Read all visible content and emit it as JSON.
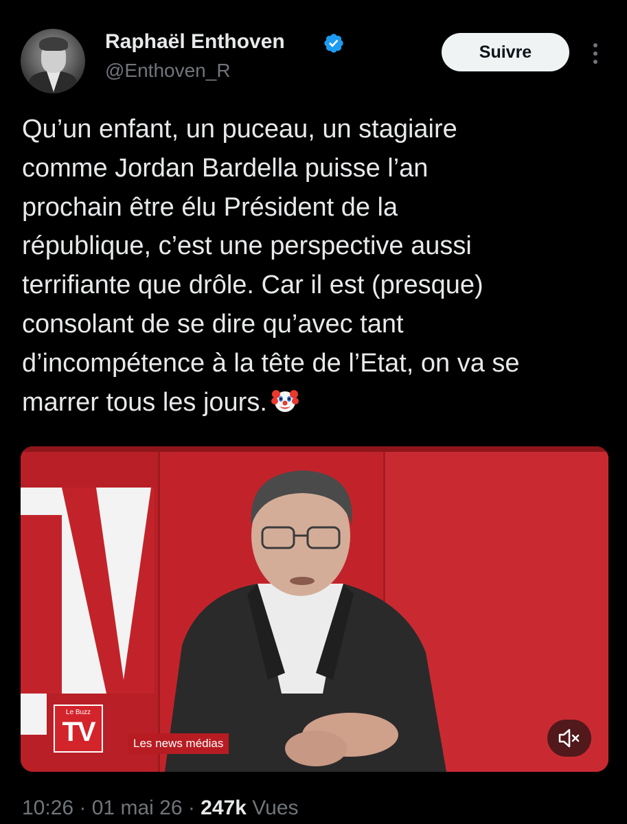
{
  "author": {
    "display_name": "Raphaël Enthoven",
    "handle": "@Enthoven_R",
    "verified": true,
    "avatar_icon": "profile-photo"
  },
  "actions": {
    "follow_label": "Suivre",
    "more_icon": "more-vertical-icon"
  },
  "tweet": {
    "lines": [
      "Qu’un enfant, un puceau, un stagiaire",
      "comme Jordan Bardella puisse l’an",
      "prochain être élu Président de la",
      "république, c’est une perspective aussi",
      "terrifiante que drôle. Car il est (presque)",
      "consolant de se dire qu’avec tant",
      "d’incompétence à la tête de l’Etat, on va se",
      "marrer tous les jours."
    ],
    "emoji_icon": "clown-face-icon"
  },
  "media": {
    "type": "video",
    "background_sign_text": "TV",
    "logo_small": "Le Buzz",
    "logo_big": "TV",
    "lower_third": "Les news médias",
    "mute_icon": "speaker-muted-icon"
  },
  "meta": {
    "time": "10:26",
    "separator": " · ",
    "date": "01 mai 26",
    "views_count": "247k",
    "views_label": "Vues"
  },
  "colors": {
    "background": "#000000",
    "text": "#e7e9ea",
    "secondary_text": "#71767b",
    "verified": "#1d9bf0",
    "video_red": "#c2232a"
  }
}
